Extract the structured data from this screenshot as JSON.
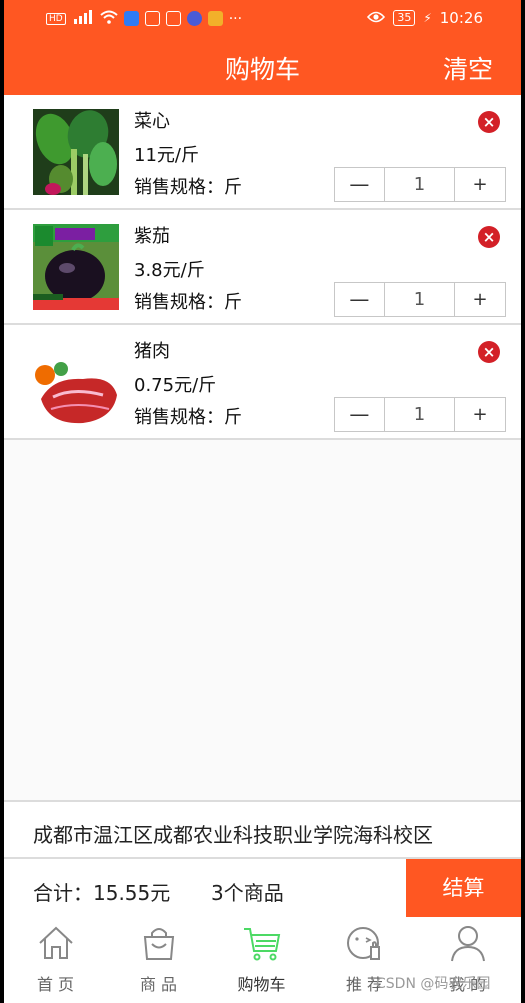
{
  "status_bar": {
    "time": "10:26",
    "battery": "35"
  },
  "header": {
    "title": "购物车",
    "clear_label": "清空"
  },
  "cart_items": [
    {
      "name": "菜心",
      "price": "11元/斤",
      "spec": "销售规格：斤",
      "qty": "1"
    },
    {
      "name": "紫茄",
      "price": "3.8元/斤",
      "spec": "销售规格：斤",
      "qty": "1"
    },
    {
      "name": "猪肉",
      "price": "0.75元/斤",
      "spec": "销售规格：斤",
      "qty": "1"
    }
  ],
  "stepper": {
    "minus": "—",
    "plus": "+"
  },
  "address": "成都市温江区成都农业科技职业学院海科校区",
  "summary": {
    "total": "合计：15.55元",
    "count": "3个商品",
    "checkout_label": "结算"
  },
  "tabs": [
    {
      "label": "首 页",
      "icon": "home-icon"
    },
    {
      "label": "商 品",
      "icon": "bag-icon"
    },
    {
      "label": "购物车",
      "icon": "cart-icon"
    },
    {
      "label": "推 荐",
      "icon": "recommend-icon"
    },
    {
      "label": "我 的",
      "icon": "user-icon"
    }
  ],
  "watermark": "CSDN @码农乐园",
  "colors": {
    "brand": "#ff5722",
    "active_tab": "#4cd964",
    "delete": "#d32027"
  }
}
